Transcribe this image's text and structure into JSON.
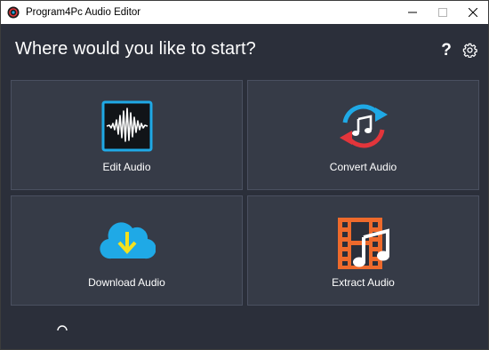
{
  "window": {
    "title": "Program4Pc Audio Editor",
    "controls": [
      "minimize",
      "maximize",
      "close"
    ]
  },
  "main": {
    "heading": "Where would you like to start?",
    "help_symbol": "?",
    "tiles": [
      {
        "label": "Edit Audio",
        "icon": "waveform-icon"
      },
      {
        "label": "Convert Audio",
        "icon": "convert-music-icon"
      },
      {
        "label": "Download Audio",
        "icon": "cloud-download-icon"
      },
      {
        "label": "Extract Audio",
        "icon": "film-music-icon"
      }
    ]
  },
  "colors": {
    "background": "#2b2f3a",
    "tile": "#363b47",
    "tile_border": "#4a5060",
    "accent_blue": "#1fa9e6",
    "accent_red": "#e2353b",
    "accent_orange": "#ee6a2c",
    "accent_yellow": "#f4e11d",
    "text": "#ffffff"
  }
}
